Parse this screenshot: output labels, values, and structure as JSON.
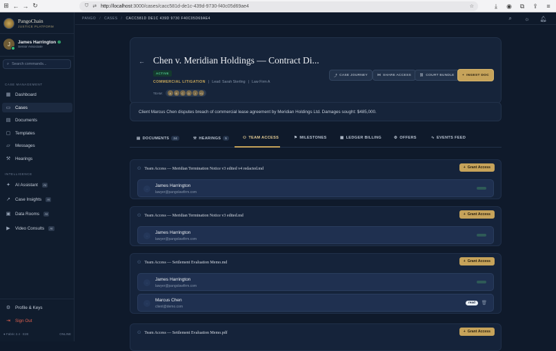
{
  "browser": {
    "url_host": "http://localhost",
    "url_path": ":3000/cases/cacc581d-de1c-439d-9730-f40c05d69ae4"
  },
  "sidebar": {
    "brand_name": "PangoChain",
    "brand_sub": "JUSTICE PLATFORM",
    "user_initial": "J",
    "user_name": "James Harrington",
    "user_role": "Senior Associate",
    "search_placeholder": "Search commands...",
    "section_case": "CASE MANAGEMENT",
    "section_intel": "INTELLIGENCE",
    "items": [
      {
        "label": "Dashboard",
        "icon": "grid-icon"
      },
      {
        "label": "Cases",
        "icon": "folder-icon"
      },
      {
        "label": "Documents",
        "icon": "document-icon"
      },
      {
        "label": "Templates",
        "icon": "template-icon"
      },
      {
        "label": "Messages",
        "icon": "message-icon"
      },
      {
        "label": "Hearings",
        "icon": "gavel-icon"
      }
    ],
    "intel_items": [
      {
        "label": "AI Assistant",
        "badge": "AI"
      },
      {
        "label": "Case Insights",
        "badge": "AI"
      },
      {
        "label": "Data Rooms",
        "badge": "AI"
      },
      {
        "label": "Video Consults",
        "badge": "AI"
      }
    ],
    "profile_label": "Profile & Keys",
    "signout_label": "Sign Out",
    "footer_left": "● Fabric 2.4 · E2E",
    "footer_right": "ONLINE"
  },
  "topbar": {
    "crumbs": [
      "PANGO",
      "CASES",
      "CACC581D DE1C 439D 9730 F40C05D69AE4"
    ]
  },
  "case": {
    "title": "Chen v. Meridian Holdings — Contract Di...",
    "status": "ACTIVE",
    "category": "COMMERCIAL LITIGATION",
    "lead": "Lead: Sarah Sterling",
    "firm": "Law Firm A",
    "team_label": "TEAM:",
    "team_initials": [
      "A",
      "B",
      "C",
      "D",
      "J",
      "+1"
    ],
    "actions": [
      "CASE JOURNEY",
      "SHARE ACCESS",
      "COURT BUNDLE",
      "INGEST DOC"
    ],
    "description": "Client Marcus Chen disputes breach of commercial lease agreement by Meridian Holdings Ltd. Damages sought: $485,000."
  },
  "tabs": [
    {
      "label": "DOCUMENTS",
      "count": "24"
    },
    {
      "label": "HEARINGS",
      "count": "5"
    },
    {
      "label": "TEAM ACCESS",
      "count": ""
    },
    {
      "label": "MILESTONES",
      "count": ""
    },
    {
      "label": "LEDGER BILLING",
      "count": ""
    },
    {
      "label": "OFFERS",
      "count": ""
    },
    {
      "label": "EVENTS FEED",
      "count": ""
    }
  ],
  "sections": [
    {
      "title": "Team Access — Meridian Termination Notice v3 edited v4 redacted.md",
      "grant": "Grant Access",
      "members": [
        {
          "name": "James Harrington",
          "email": "lawyer@pangolawfirm.com"
        }
      ]
    },
    {
      "title": "Team Access — Meridian Termination Notice v3 edited.md",
      "grant": "Grant Access",
      "members": [
        {
          "name": "James Harrington",
          "email": "lawyer@pangolawfirm.com"
        }
      ]
    },
    {
      "title": "Team Access — Settlement Evaluation Memo.md",
      "grant": "Grant Access",
      "members": [
        {
          "name": "James Harrington",
          "email": "lawyer@pangolawfirm.com"
        },
        {
          "name": "Marcus Chen",
          "email": "client@demo.com",
          "badge": "read"
        }
      ]
    },
    {
      "title": "Team Access — Settlement Evaluation Memo.pdf",
      "grant": "Grant Access",
      "members": []
    }
  ]
}
